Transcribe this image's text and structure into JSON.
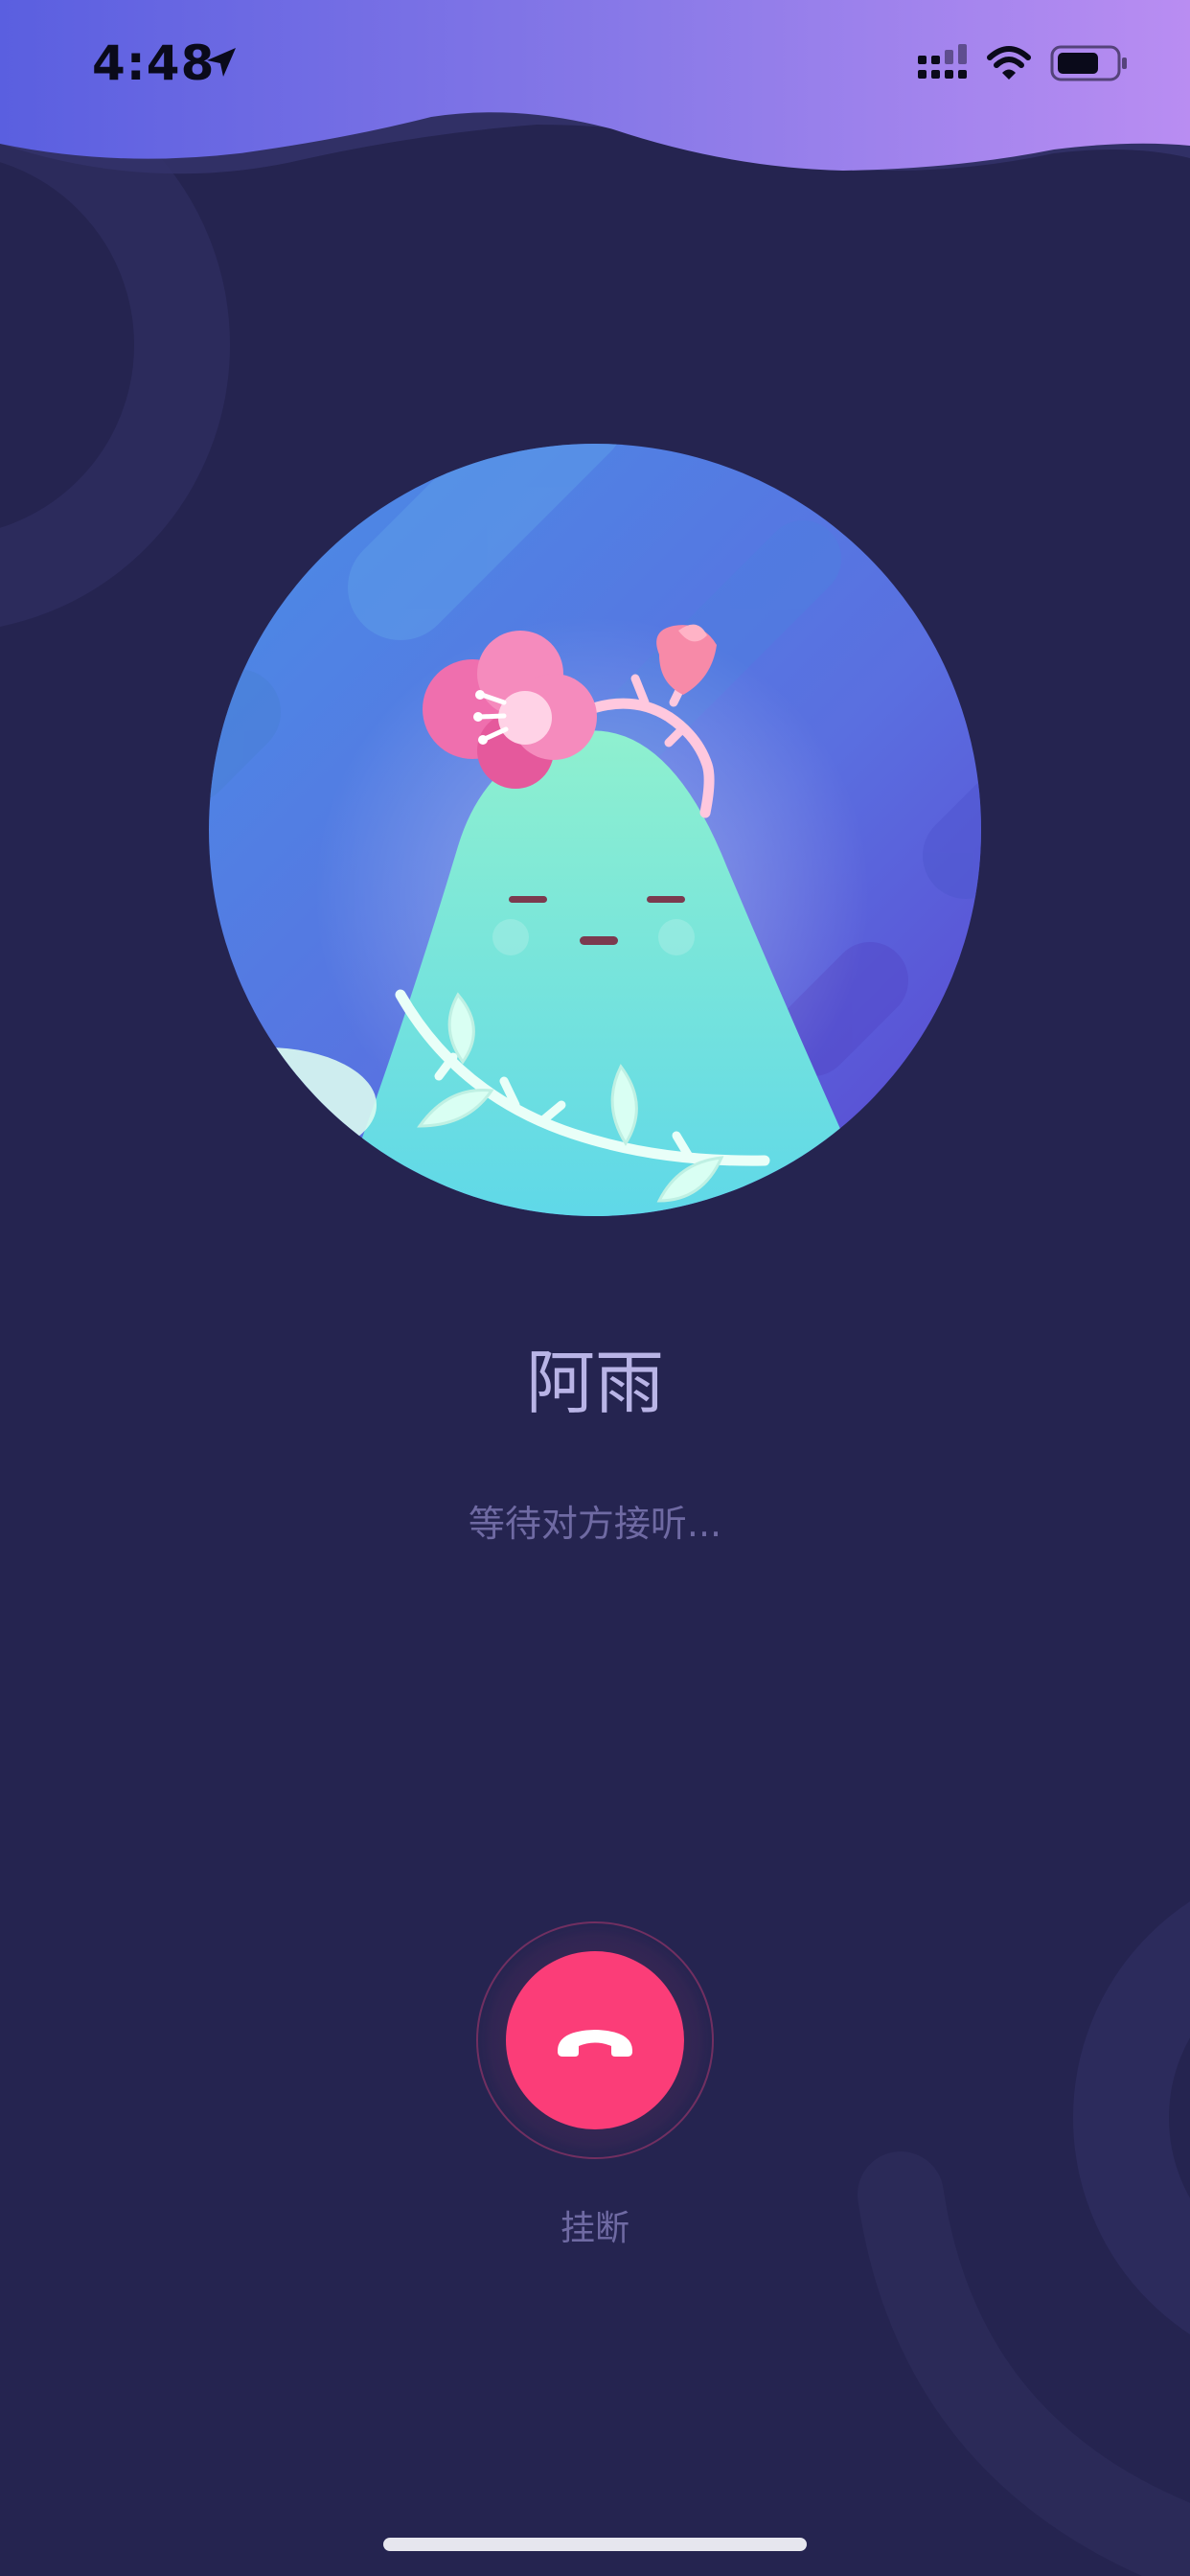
{
  "status_bar": {
    "time": "4:48",
    "icons": [
      "location-arrow-icon",
      "cellular-signal-icon",
      "wifi-icon",
      "battery-icon"
    ]
  },
  "call": {
    "caller_name": "阿雨",
    "status_text": "等待对方接听...",
    "avatar_icon": "mountain-spirit-with-flower-avatar"
  },
  "actions": {
    "hangup_label": "挂断",
    "hangup_icon": "phone-hangup-icon"
  },
  "colors": {
    "background": "#252450",
    "header_gradient_start": "#5a5fe0",
    "header_gradient_end": "#b98df2",
    "hangup_button": "#fb3d78",
    "caller_name": "#b9b4e6",
    "secondary_text": "#6f6aa3"
  }
}
